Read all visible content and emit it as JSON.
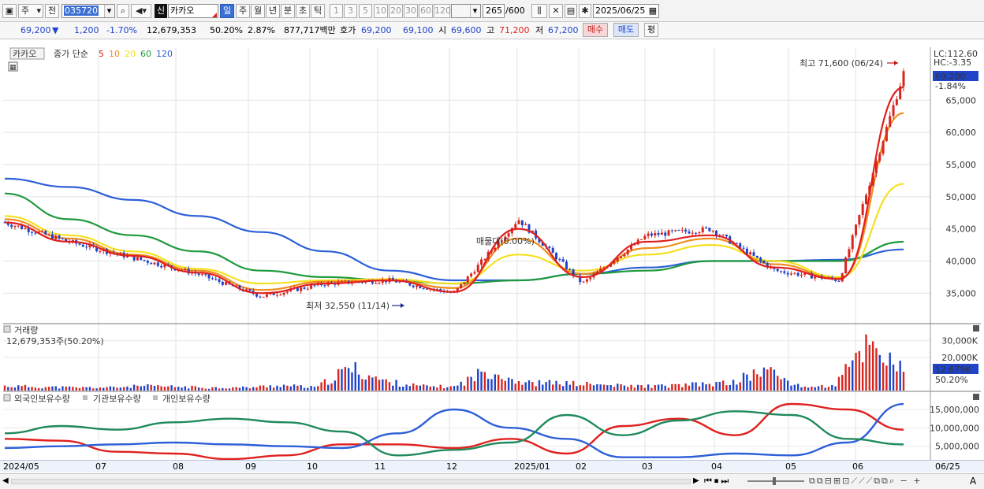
{
  "toolbar": {
    "menu_label": "주",
    "prev_label": "전",
    "code_value": "035720",
    "new_badge": "신",
    "stock_name": "카카오",
    "period_tabs": [
      {
        "label": "일",
        "selected": true
      },
      {
        "label": "주",
        "selected": false
      },
      {
        "label": "월",
        "selected": false
      },
      {
        "label": "년",
        "selected": false
      },
      {
        "label": "분",
        "selected": false
      },
      {
        "label": "초",
        "selected": false
      },
      {
        "label": "틱",
        "selected": false
      }
    ],
    "interval_buttons": [
      "1",
      "3",
      "5",
      "10",
      "20",
      "30",
      "60",
      "120"
    ],
    "count_value": "265",
    "count_total": "/600",
    "date_value": "2025/06/25"
  },
  "quote": {
    "price": "69,200",
    "change_icon": "down-triangle-icon",
    "change": "1,200",
    "change_pct": "-1.70%",
    "volume": "12,679,353",
    "volume_ratio": "50.20%",
    "turnover_pct": "2.87%",
    "amount": "877,717백만",
    "bid_label": "호가",
    "ask_price": "69,200",
    "bid_price": "69,100",
    "open_label": "시",
    "open": "69,600",
    "high_label": "고",
    "high": "71,200",
    "low_label": "저",
    "low": "67,200",
    "buy_label": "매수",
    "sell_label": "매도",
    "balance_label": "평"
  },
  "price_panel": {
    "stock_label": "카카오",
    "legend_prefix": "종가 단순",
    "ma_labels": [
      "5",
      "10",
      "20",
      "60",
      "120"
    ],
    "ma_colors": [
      "#e0201e",
      "#f08c1e",
      "#f5e020",
      "#1f9a3c",
      "#2d5fd8"
    ],
    "overlay_text": "매물대(0.00%)",
    "lc_label": "LC:112.60",
    "hc_label": "HC:-3.35",
    "current_price_tag": "69,200",
    "current_change_tag": "-1.84%",
    "high_annotation": "최고 71,600 (06/24)",
    "low_annotation": "최저 32,550 (11/14)",
    "y_ticks": [
      "65,000",
      "60,000",
      "55,000",
      "50,000",
      "45,000",
      "40,000",
      "35,000"
    ]
  },
  "volume_panel": {
    "title": "거래량",
    "subtitle": "12,679,353주(50.20%)",
    "y_ticks": [
      "30,000K",
      "20,000K"
    ],
    "current_tag": "12,679K",
    "ratio_tag": "50.20%"
  },
  "holding_panel": {
    "series": [
      {
        "name": "외국인보유수량",
        "color": "#e0201e"
      },
      {
        "name": "기관보유수량",
        "color": "#2d5fd8"
      },
      {
        "name": "개인보유수량",
        "color": "#1f8a5c"
      }
    ],
    "y_ticks": [
      "15,000,000",
      "10,000,000",
      "5,000,000"
    ]
  },
  "x_axis_labels": [
    "2024/05",
    "07",
    "08",
    "09",
    "10",
    "11",
    "12",
    "2025/01",
    "02",
    "03",
    "04",
    "05",
    "06",
    "06/25"
  ],
  "colors": {
    "up": "#d8261e",
    "down": "#1f44c8",
    "accent": "#3b6fd4"
  },
  "chart_data": [
    {
      "type": "line",
      "title": "카카오",
      "x": [
        "2024/05",
        "07",
        "08",
        "09",
        "10",
        "11",
        "12",
        "2025/01",
        "02",
        "03",
        "04",
        "05",
        "06",
        "06/25"
      ],
      "ylim": [
        31000,
        72500
      ],
      "series": [
        {
          "name": "종가",
          "values": [
            46000,
            43000,
            40500,
            38000,
            34500,
            36500,
            37000,
            35000,
            46500,
            36500,
            44000,
            45000,
            38500,
            37000,
            69200
          ]
        },
        {
          "name": "5",
          "values": [
            46000,
            43000,
            40800,
            38200,
            35000,
            36500,
            37000,
            35200,
            45000,
            37500,
            43000,
            44000,
            39000,
            37200,
            67000
          ]
        },
        {
          "name": "10",
          "values": [
            46500,
            43500,
            41000,
            38500,
            35500,
            36800,
            37000,
            35800,
            43500,
            38000,
            42000,
            43500,
            39500,
            37300,
            63000
          ]
        },
        {
          "name": "20",
          "values": [
            47000,
            44000,
            41500,
            38800,
            36500,
            37000,
            37200,
            36500,
            41000,
            38500,
            41000,
            42500,
            40000,
            37500,
            52000
          ]
        },
        {
          "name": "60",
          "values": [
            50500,
            46500,
            44000,
            41500,
            38500,
            37500,
            37000,
            36500,
            37000,
            38000,
            38500,
            40000,
            40000,
            40000,
            43000
          ]
        },
        {
          "name": "120",
          "values": [
            52800,
            51500,
            49500,
            47000,
            44500,
            41500,
            38500,
            37000,
            37000,
            38000,
            39000,
            40000,
            40000,
            40200,
            41800
          ]
        }
      ]
    },
    {
      "type": "bar",
      "title": "거래량",
      "ylim": [
        0,
        36000000
      ],
      "values": [
        3000000,
        2500000,
        2000000,
        2000000,
        3000000,
        2500000,
        2000000,
        2000000,
        3500000,
        2000000,
        15000000,
        6000000,
        3000000,
        2500000,
        14000000,
        5000000,
        5000000,
        4000000,
        3000000,
        3000000,
        4000000,
        5000000,
        14000000,
        2500000,
        3000000,
        33000000,
        12679353
      ]
    },
    {
      "type": "line",
      "title": "보유수량",
      "ylim": [
        0,
        18000000
      ],
      "series": [
        {
          "name": "외국인보유수량",
          "values": [
            7000000,
            6500000,
            3500000,
            3000000,
            1500000,
            2500000,
            5500000,
            5500000,
            4500000,
            7000000,
            3000000,
            10500000,
            12500000,
            8000000,
            16500000,
            15000000,
            9500000
          ]
        },
        {
          "name": "기관보유수량",
          "values": [
            4500000,
            5000000,
            5500000,
            6000000,
            5500000,
            5000000,
            4500000,
            8500000,
            15000000,
            10000000,
            7000000,
            2000000,
            2000000,
            3000000,
            2500000,
            6000000,
            16500000
          ]
        },
        {
          "name": "개인보유수량",
          "values": [
            8500000,
            10500000,
            9500000,
            11500000,
            12500000,
            11500000,
            9000000,
            2500000,
            4000000,
            6000000,
            13500000,
            8000000,
            12000000,
            14500000,
            13500000,
            7000000,
            5500000
          ]
        }
      ]
    }
  ]
}
